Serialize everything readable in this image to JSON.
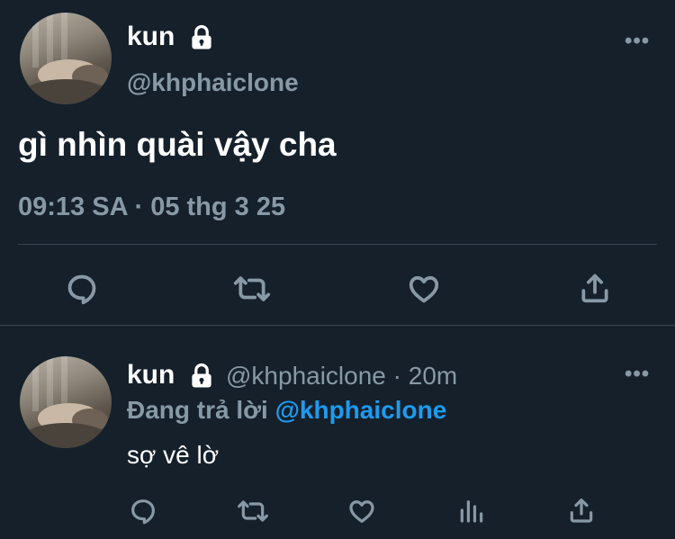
{
  "main_tweet": {
    "display_name": "kun",
    "handle": "@khphaiclone",
    "text": "gì nhìn quài vậy cha",
    "timestamp": "09:13 SA · 05 thg 3 25",
    "more_label": "•••"
  },
  "reply_tweet": {
    "display_name": "kun",
    "handle": "@khphaiclone",
    "separator": "·",
    "age": "20m",
    "replying_prefix": "Đang trả lời",
    "replying_to": "@khphaiclone",
    "text": "sợ vê lờ",
    "more_label": "•••"
  },
  "icons": {
    "lock": "lock-icon",
    "reply": "reply-icon",
    "retweet": "retweet-icon",
    "like": "like-icon",
    "share": "share-icon",
    "analytics": "analytics-icon",
    "more": "more-icon"
  },
  "colors": {
    "background": "#15202b",
    "text_primary": "#ffffff",
    "text_secondary": "#8899a6",
    "link": "#1d9bf0",
    "divider": "#38444d"
  }
}
